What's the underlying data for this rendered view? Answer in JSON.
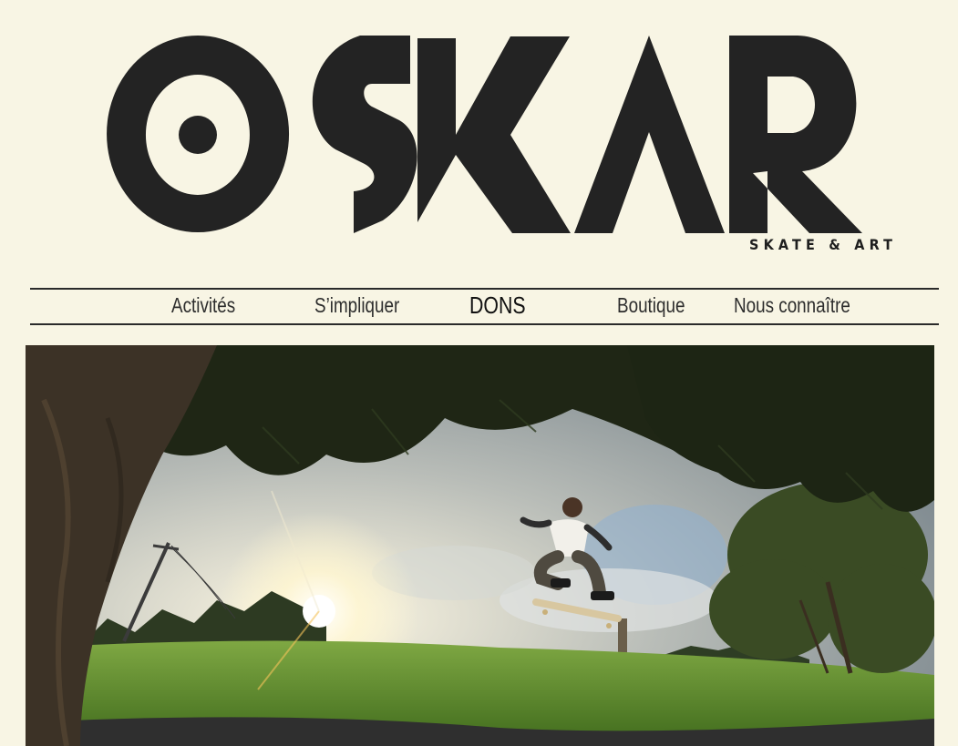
{
  "brand": {
    "logo_text": "OSKAR",
    "tagline": "SKATE & ART"
  },
  "nav": {
    "items": [
      {
        "label": "Activités"
      },
      {
        "label": "S’impliquer"
      },
      {
        "label": "DONS"
      },
      {
        "label": "Boutique"
      },
      {
        "label": "Nous connaître"
      }
    ]
  },
  "hero": {
    "image_subject": "skateboarder-kickflip-photo"
  },
  "colors": {
    "background": "#f8f5e4",
    "ink": "#232323"
  }
}
